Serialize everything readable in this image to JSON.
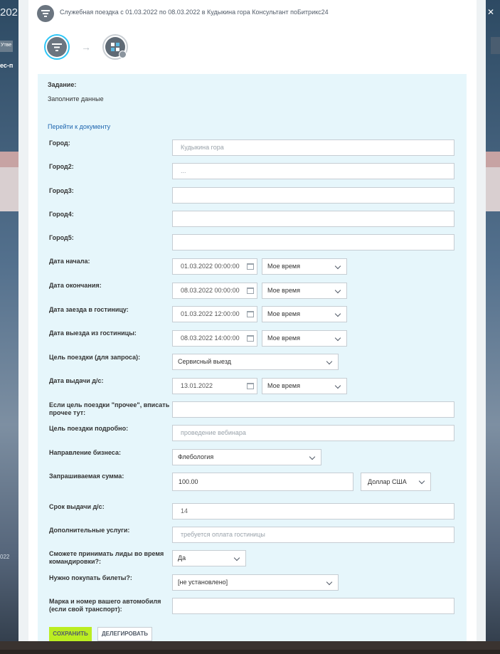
{
  "background": {
    "year_fragment": "202",
    "tab_fragment": "Утве",
    "link_fragment": "ес-п",
    "year_fragment_2": "022"
  },
  "header": {
    "title": "Служебная поездка с 01.03.2022 по 08.03.2022 в Кудыкина гора Консультант поБитрикс24"
  },
  "task": {
    "label": "Задание:",
    "description": "Заполните данные",
    "doc_link": "Перейти к документу"
  },
  "form": {
    "city": {
      "label": "Город:",
      "placeholder": "Кудыкина гора"
    },
    "city2": {
      "label": "Город2:",
      "placeholder": "..."
    },
    "city3": {
      "label": "Город3:",
      "value": ""
    },
    "city4": {
      "label": "Город4:",
      "value": ""
    },
    "city5": {
      "label": "Город5:",
      "value": ""
    },
    "start_date": {
      "label": "Дата начала:",
      "date": "01.03.2022 00:00:00",
      "tz": "Мое время"
    },
    "end_date": {
      "label": "Дата окончания:",
      "date": "08.03.2022 00:00:00",
      "tz": "Мое время"
    },
    "checkin_date": {
      "label": "Дата заезда в гостиницу:",
      "date": "01.03.2022 12:00:00",
      "tz": "Мое время"
    },
    "checkout_date": {
      "label": "Дата выезда из гостиницы:",
      "date": "08.03.2022 14:00:00",
      "tz": "Мое время"
    },
    "trip_purpose": {
      "label": "Цель поездки (для запроса):",
      "value": "Сервисный выезд"
    },
    "advance_date": {
      "label": "Дата выдачи д/с:",
      "date": "13.01.2022",
      "tz": "Мое время"
    },
    "other_purpose": {
      "label": "Если цель поездки \"прочее\", вписать прочее тут:",
      "value": ""
    },
    "purpose_detail": {
      "label": "Цель поездки подробно:",
      "placeholder": "проведение вебинара"
    },
    "business_direction": {
      "label": "Направление бизнеса:",
      "value": "Флебология"
    },
    "requested_amount": {
      "label": "Запрашиваемая сумма:",
      "value": "100.00",
      "currency": "Доллар США"
    },
    "advance_term": {
      "label": "Срок выдачи д/с:",
      "value": "14"
    },
    "extra_services": {
      "label": "Дополнительные услуги:",
      "placeholder": "требуется оплата гостиницы"
    },
    "accept_leads": {
      "label": "Сможете принимать лиды во время командировки?:",
      "value": "Да"
    },
    "buy_tickets": {
      "label": "Нужно покупать билеты?:",
      "value": "[не установлено]"
    },
    "car": {
      "label": "Марка и номер вашего автомобиля (если свой транспорт):",
      "value": ""
    }
  },
  "buttons": {
    "save": "СОХРАНИТЬ",
    "delegate": "ДЕЛЕГИРОВАТЬ"
  },
  "colors": {
    "panel_bg": "#e6f6fb",
    "save_button": "#bbed21",
    "link": "#2067b0",
    "active_step_ring": "#2fc6f6"
  }
}
